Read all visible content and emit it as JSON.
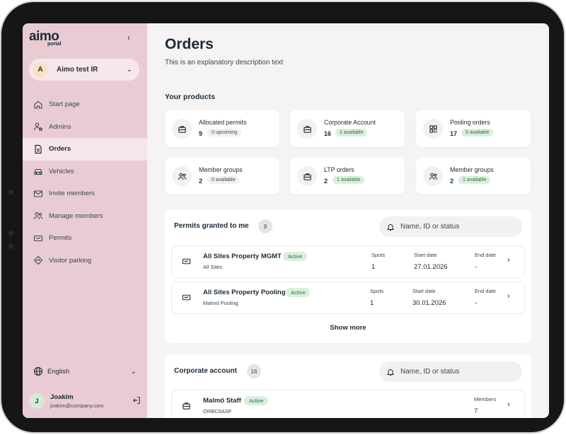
{
  "sidebar": {
    "logo": "aimo",
    "logo_sub": "portal",
    "org": {
      "initial": "A",
      "name": "Aimo test IR"
    },
    "items": [
      {
        "label": "Start page",
        "icon": "home-icon"
      },
      {
        "label": "Admins",
        "icon": "admins-icon"
      },
      {
        "label": "Orders",
        "icon": "document-icon",
        "active": true
      },
      {
        "label": "Vehicles",
        "icon": "car-icon"
      },
      {
        "label": "Invite members",
        "icon": "mail-icon"
      },
      {
        "label": "Manage members",
        "icon": "users-icon"
      },
      {
        "label": "Permits",
        "icon": "ticket-icon"
      },
      {
        "label": "Visitor parking",
        "icon": "diamond-arrow-icon"
      }
    ],
    "language": "English",
    "user": {
      "initial": "J",
      "name": "Joakim",
      "email": "joakim@company.com"
    }
  },
  "main": {
    "title": "Orders",
    "description": "This is an explanatory description text",
    "products_title": "Your products",
    "products": [
      {
        "label": "Allocated permits",
        "count": "9",
        "badge": "0 upcoming",
        "badge_style": "grey",
        "icon": "bag-icon"
      },
      {
        "label": "Corporate Account",
        "count": "16",
        "badge": "2 available",
        "badge_style": "green",
        "icon": "bag-icon"
      },
      {
        "label": "Pooling orders",
        "count": "17",
        "badge": "5 available",
        "badge_style": "green",
        "icon": "grid-icon"
      },
      {
        "label": "Member groups",
        "count": "2",
        "badge": "0 available",
        "badge_style": "grey",
        "icon": "users-icon"
      },
      {
        "label": "LTP orders",
        "count": "2",
        "badge": "1 available",
        "badge_style": "green",
        "icon": "bag-icon"
      },
      {
        "label": "Member groups",
        "count": "2",
        "badge": "1 available",
        "badge_style": "green",
        "icon": "users-icon"
      }
    ],
    "permits": {
      "title": "Permits granted to me",
      "count": "9",
      "search_placeholder": "Name, ID or status",
      "columns": {
        "spots": "Spots",
        "start": "Start date",
        "end": "End date"
      },
      "rows": [
        {
          "name": "All Sites Property MGMT",
          "sub": "All Sites",
          "status": "Active",
          "spots": "1",
          "start": "27.01.2026",
          "end": "-"
        },
        {
          "name": "All Sites Property Pooling",
          "sub": "Malmö Pooling",
          "status": "Active",
          "spots": "1",
          "start": "30.01.2026",
          "end": "-"
        }
      ],
      "show_more": "Show more"
    },
    "corporate": {
      "title": "Corporate account",
      "count": "16",
      "search_placeholder": "Name, ID or status",
      "columns": {
        "members": "Members"
      },
      "rows": [
        {
          "name": "Malmö Staff",
          "sub": "ORBC6ASF",
          "status": "Active",
          "members": "7"
        }
      ]
    }
  }
}
